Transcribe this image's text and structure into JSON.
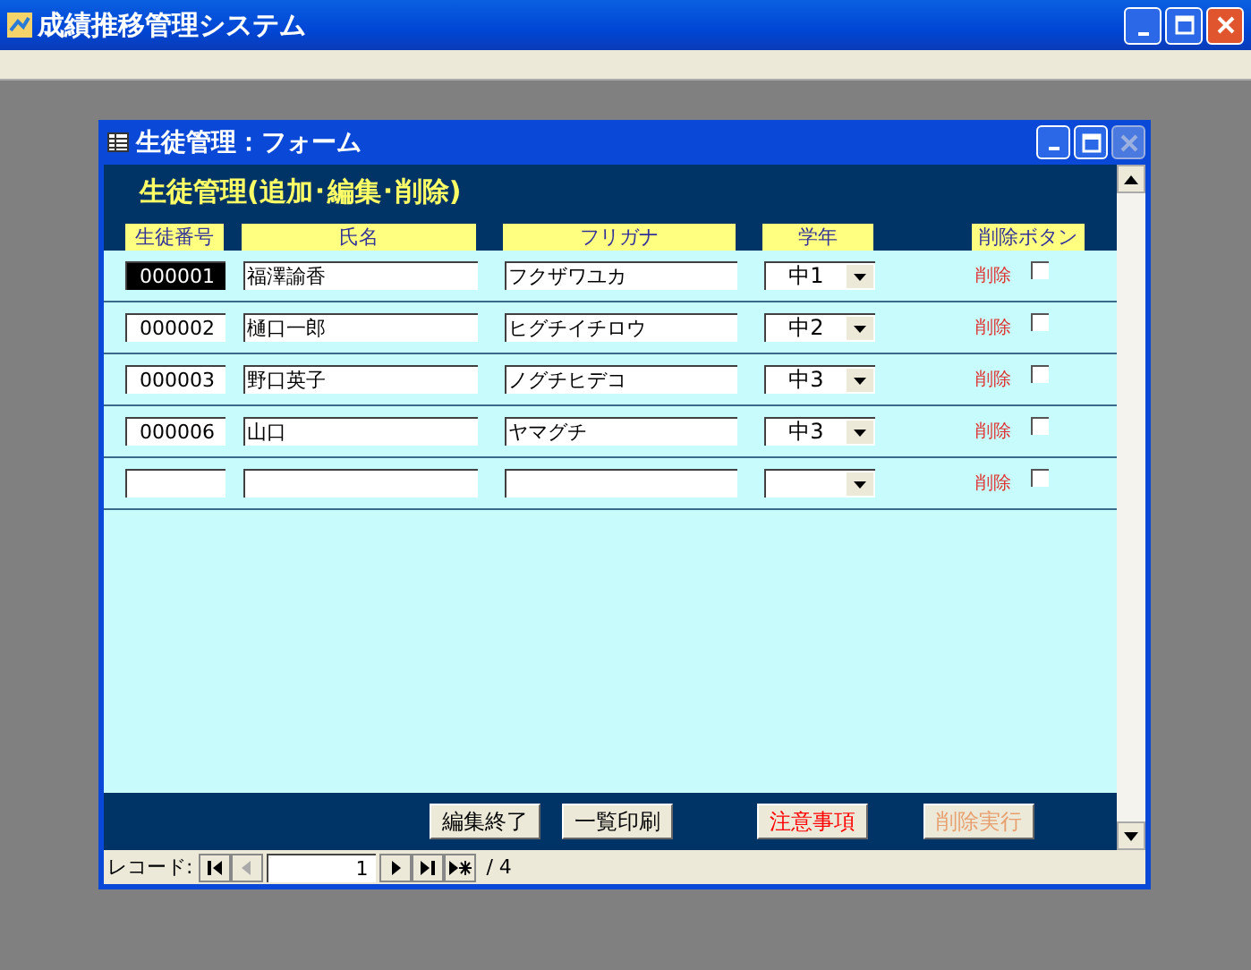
{
  "app_window": {
    "title": "成績推移管理システム"
  },
  "form_window": {
    "title": "生徒管理：フォーム",
    "close_disabled": true
  },
  "form": {
    "heading": "生徒管理(追加･編集･削除)",
    "columns": [
      "生徒番号",
      "氏名",
      "フリガナ",
      "学年",
      "削除ボタン"
    ],
    "rows": [
      {
        "id": "000001",
        "name": "福澤諭香",
        "kana": "フクザワユカ",
        "grade": "中1",
        "delete_label": "削除",
        "checked": false,
        "selected": true
      },
      {
        "id": "000002",
        "name": "樋口一郎",
        "kana": "ヒグチイチロウ",
        "grade": "中2",
        "delete_label": "削除",
        "checked": false,
        "selected": false
      },
      {
        "id": "000003",
        "name": "野口英子",
        "kana": "ノグチヒデコ",
        "grade": "中3",
        "delete_label": "削除",
        "checked": false,
        "selected": false
      },
      {
        "id": "000006",
        "name": "山口",
        "kana": "ヤマグチ",
        "grade": "中3",
        "delete_label": "削除",
        "checked": false,
        "selected": false
      },
      {
        "delete_label": "削除",
        "checked": false,
        "selected": false
      }
    ],
    "buttons": [
      {
        "label": "編集終了",
        "kind": "normal",
        "disabled": false
      },
      {
        "label": "一覧印刷",
        "kind": "normal",
        "disabled": false
      },
      {
        "label": "注意事項",
        "kind": "warning",
        "disabled": false
      },
      {
        "label": "削除実行",
        "kind": "normal",
        "disabled": true
      }
    ]
  },
  "record_nav": {
    "label": "レコード:",
    "value": "1",
    "total": "/ 4",
    "buttons": [
      {
        "kind": "first",
        "disabled": false
      },
      {
        "kind": "prev",
        "disabled": true
      },
      {
        "kind": "next",
        "disabled": false
      },
      {
        "kind": "last",
        "disabled": false
      },
      {
        "kind": "new",
        "disabled": false
      }
    ]
  }
}
